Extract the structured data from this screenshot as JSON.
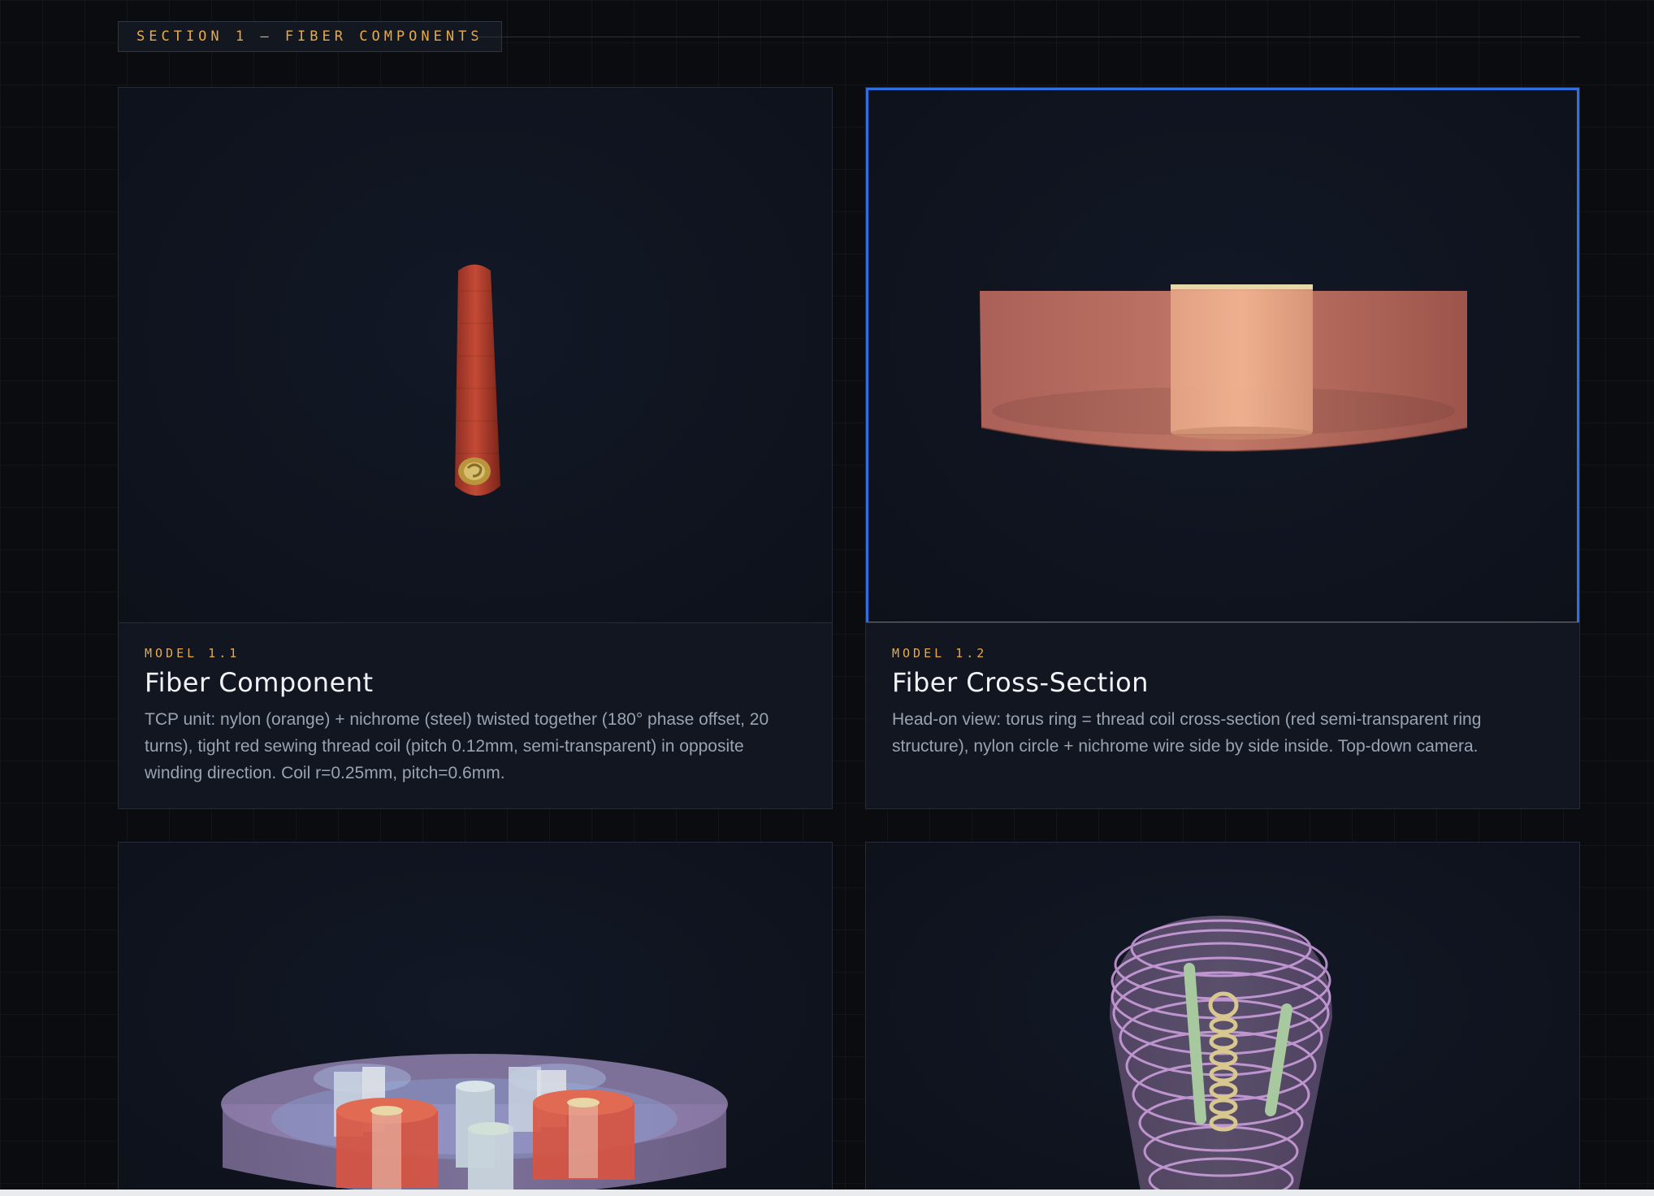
{
  "section": {
    "label": "SECTION 1 — FIBER COMPONENTS"
  },
  "cards": [
    {
      "model": "MODEL 1.1",
      "title": "Fiber Component",
      "description": "TCP unit: nylon (orange) + nichrome (steel) twisted together (180° phase offset, 20 turns), tight red sewing thread coil (pitch 0.12mm, semi-transparent) in opposite winding direction. Coil r=0.25mm, pitch=0.6mm."
    },
    {
      "model": "MODEL 1.2",
      "title": "Fiber Cross-Section",
      "description": "Head-on view: torus ring = thread coil cross-section (red semi-transparent ring structure), nylon circle + nichrome wire side by side inside. Top-down camera.",
      "selected": true
    }
  ],
  "colors": {
    "accent": "#e8a94a",
    "selection": "#2f6fe0",
    "background": "#0a0c10",
    "card": "#111620"
  }
}
